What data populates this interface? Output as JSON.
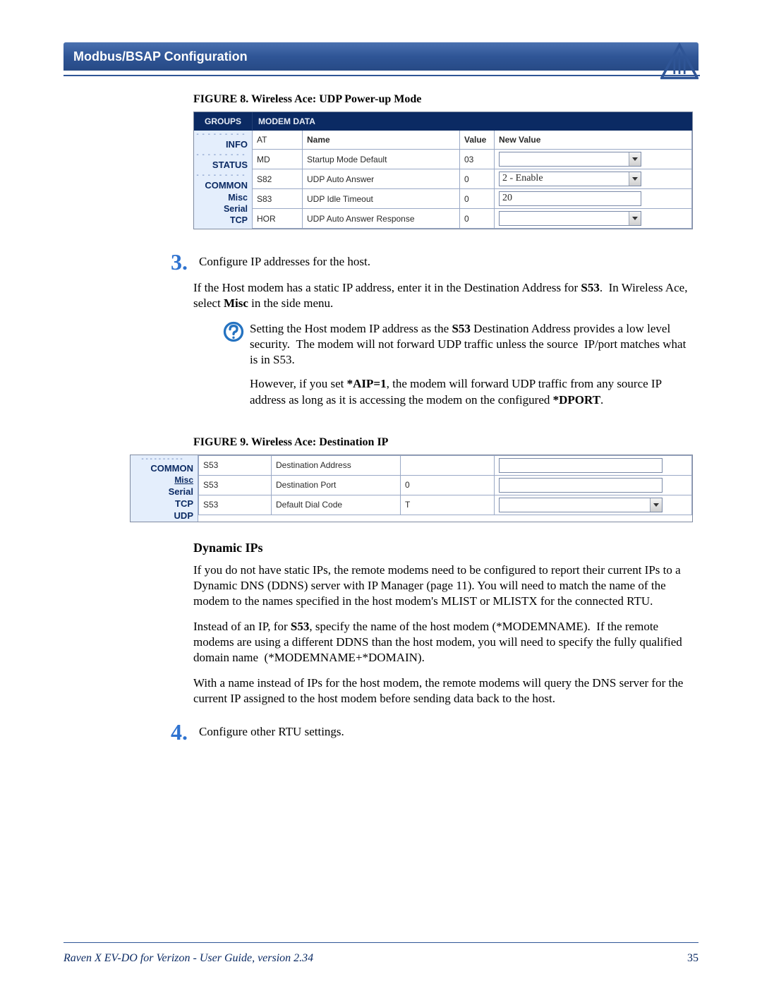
{
  "header": {
    "title": "Modbus/BSAP Configuration"
  },
  "figure8": {
    "caption": "FIGURE 8.  Wireless Ace: UDP Power-up Mode",
    "topbar": {
      "groups": "GROUPS",
      "modem": "MODEM DATA"
    },
    "cols": {
      "at": "AT",
      "name": "Name",
      "value": "Value",
      "newvalue": "New Value"
    },
    "side": [
      "INFO",
      "STATUS",
      "COMMON",
      "Misc",
      "Serial",
      "TCP"
    ],
    "rows": [
      {
        "at": "MD",
        "name": "Startup Mode Default",
        "value": "03",
        "nv": "",
        "kind": "select"
      },
      {
        "at": "S82",
        "name": "UDP Auto Answer",
        "value": "0",
        "nv": "2 - Enable",
        "kind": "select"
      },
      {
        "at": "S83",
        "name": "UDP Idle Timeout",
        "value": "0",
        "nv": "20",
        "kind": "text"
      },
      {
        "at": "HOR",
        "name": "UDP Auto Answer Response",
        "value": "0",
        "nv": "",
        "kind": "select"
      }
    ]
  },
  "step3": {
    "num": "3.",
    "text": "Configure IP addresses for the host."
  },
  "para1": "If the Host modem has a static IP address, enter it in the Destination Address for S53.  In Wireless Ace, select Misc in the side menu.",
  "help": {
    "p1": "Setting the Host modem IP address as the S53 Destination Address provides a low level security.  The modem will not forward UDP traffic unless the source  IP/port matches what is in S53.",
    "p2": "However, if you set *AIP=1, the modem will forward UDP traffic from any source IP address as long as it is accessing the modem on the configured *DPORT."
  },
  "figure9": {
    "caption": "FIGURE 9.  Wireless Ace: Destination IP",
    "side": [
      "COMMON",
      "Misc",
      "Serial",
      "TCP",
      "UDP"
    ],
    "rows": [
      {
        "at": "S53",
        "name": "Destination Address",
        "value": "",
        "kind": "text"
      },
      {
        "at": "S53",
        "name": "Destination Port",
        "value": "0",
        "kind": "text"
      },
      {
        "at": "S53",
        "name": "Default Dial Code",
        "value": "T",
        "kind": "select"
      }
    ]
  },
  "subheading": "Dynamic IPs",
  "para2": "If you do not have static IPs, the remote modems need to be configured to report their current IPs to a Dynamic DNS (DDNS) server with IP Manager (page 11). You will need to match the name of the modem to the names specified in the host modem's MLIST or MLISTX for the connected RTU.",
  "para3": "Instead of an IP, for S53, specify the name of the host modem (*MODEMNAME).  If the remote modems are using a different DDNS than the host modem, you will need to specify the fully qualified domain name  (*MODEMNAME+*DOMAIN).",
  "para4": "With a name instead of IPs for the host modem, the remote modems will query the DNS server for the current IP assigned to the host modem before sending data back to the host.",
  "step4": {
    "num": "4.",
    "text": "Configure other RTU settings."
  },
  "footer": {
    "left": "Raven X EV-DO for Verizon - User Guide, version 2.34",
    "page": "35"
  }
}
